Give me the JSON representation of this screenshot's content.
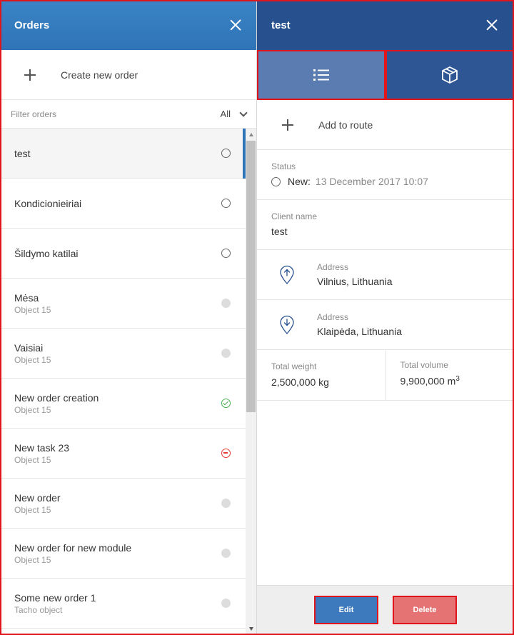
{
  "orders_panel": {
    "title": "Orders",
    "create_label": "Create new order",
    "filter_placeholder": "Filter orders",
    "filter_value": "All",
    "items": [
      {
        "name": "test",
        "sub": "",
        "status": "open"
      },
      {
        "name": "Kondicionieiriai",
        "sub": "",
        "status": "open"
      },
      {
        "name": "Šildymo katilai",
        "sub": "",
        "status": "open"
      },
      {
        "name": "Mėsa",
        "sub": "Object 15",
        "status": "grey"
      },
      {
        "name": "Vaisiai",
        "sub": "Object 15",
        "status": "grey"
      },
      {
        "name": "New order creation",
        "sub": "Object 15",
        "status": "done"
      },
      {
        "name": "New task 23",
        "sub": "Object 15",
        "status": "stop"
      },
      {
        "name": "New order",
        "sub": "Object 15",
        "status": "grey"
      },
      {
        "name": "New order for new module",
        "sub": "Object 15",
        "status": "grey"
      },
      {
        "name": "Some new order 1",
        "sub": "Tacho object",
        "status": "grey"
      }
    ]
  },
  "detail_panel": {
    "title": "test",
    "add_to_route_label": "Add to route",
    "status": {
      "label": "Status",
      "value": "New:",
      "date": "13 December 2017 10:07"
    },
    "client": {
      "label": "Client name",
      "value": "test"
    },
    "pickup": {
      "label": "Address",
      "value": "Vilnius, Lithuania"
    },
    "delivery": {
      "label": "Address",
      "value": "Klaipėda, Lithuania"
    },
    "total_weight": {
      "label": "Total weight",
      "value": "2,500,000 kg"
    },
    "total_volume": {
      "label": "Total volume",
      "value": "9,900,000 m",
      "unit_sup": "3"
    },
    "edit_label": "Edit",
    "delete_label": "Delete"
  },
  "colors": {
    "orders_header": "#2f74b6",
    "detail_header": "#27508f",
    "tab_selected": "#5b7cb0",
    "edit_button": "#3d7abd",
    "delete_button": "#e57373",
    "highlight_border": "#e0151b"
  },
  "icons": {
    "tab_list": "list-icon",
    "tab_package": "package-icon",
    "pickup": "pin-arrow-up-icon",
    "delivery": "pin-arrow-down-icon"
  }
}
